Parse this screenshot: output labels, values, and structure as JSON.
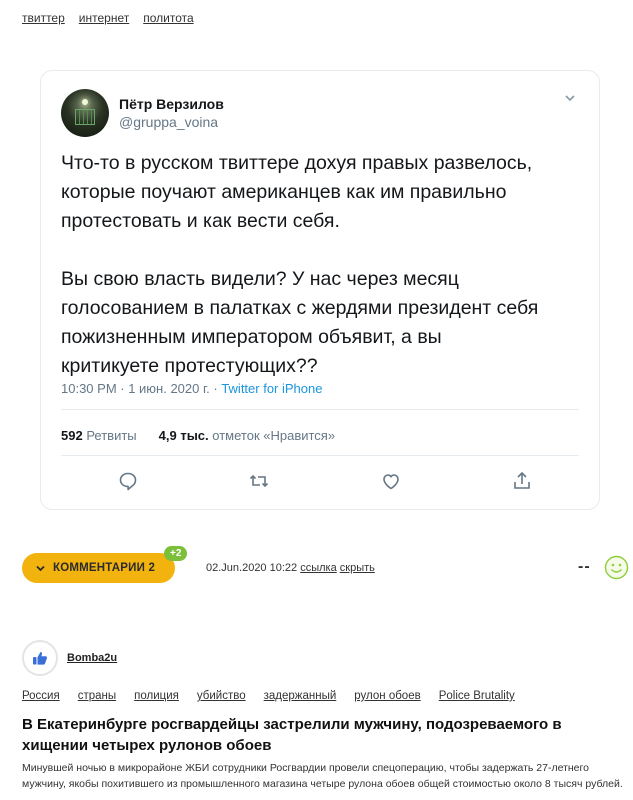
{
  "tags": [
    "твиттер",
    "интернет",
    "политота"
  ],
  "tweet": {
    "name": "Пётр Верзилов",
    "handle": "@gruppa_voina",
    "text": "Что-то в русском твиттере дохуя правых развелось,\nкоторые поучают американцев как им правильно\nпротестовать и как вести себя.\n\nВы свою власть видели? У нас через месяц\nголосованием в палатках с жердями президент себя\nпожизненным императором объявит, а вы\nкритикуете протестующих??",
    "time": "10:30 PM · 1 июн. 2020 г. · ",
    "source": "Twitter for iPhone",
    "retweets_count": "592",
    "retweets_label": "Ретвиты",
    "likes_count": "4,9 тыс.",
    "likes_label": "отметок «Нравится»"
  },
  "comments": {
    "button_label": "КОММЕНТАРИИ 2",
    "plus_badge": "+2",
    "date": "02.Jun.2020 10:22",
    "link_label": "ссылка",
    "hide_label": "скрыть",
    "rating": "--"
  },
  "next_post": {
    "author": "Bomba2u",
    "tags": [
      "Россия",
      "страны",
      "полиция",
      "убийство",
      "задержанный",
      "рулон обоев",
      "Police Brutality"
    ],
    "title": "В Екатеринбурге росгвардейцы застрелили мужчину, подозреваемого в хищении четырех рулонов обоев",
    "body": "Минувшей ночью в микрорайоне ЖБИ сотрудники Росгвардии провели спецоперацию, чтобы задержать 27-летнего мужчину, якобы похитившего из промышленного магазина четыре рулона обоев общей стоимостью около 8 тысяч рублей."
  },
  "colors": {
    "accent": "#f2b30f",
    "badge_green": "#7cbf3b",
    "twitter_blue": "#1b95e0"
  },
  "icons": [
    "reply-icon",
    "retweet-icon",
    "like-icon",
    "share-icon",
    "chevron-down-icon",
    "smiley-icon",
    "thumbs-up-icon"
  ]
}
